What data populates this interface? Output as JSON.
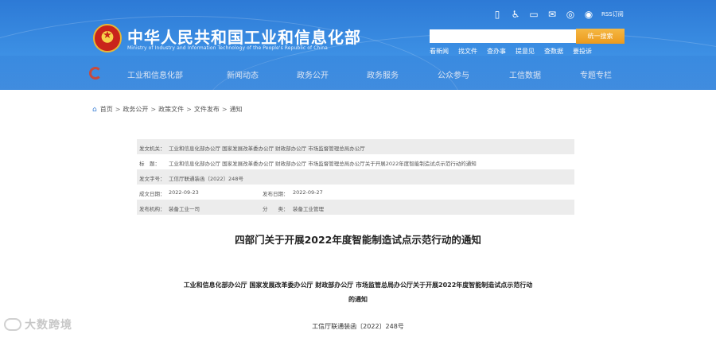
{
  "header": {
    "title": "中华人民共和国工业和信息化部",
    "subtitle": "Ministry of Industry and Information Technology of the People's Republic of China",
    "emblem_icon": "national-emblem-icon",
    "top_icons": [
      "mobile-icon",
      "accessibility-icon",
      "phone-icon",
      "mail-icon",
      "wechat-icon",
      "weibo-icon"
    ],
    "rss_label": "RSS订阅",
    "search": {
      "placeholder": "",
      "button_label": "统一搜索"
    },
    "quick_links": [
      "看新闻",
      "找文件",
      "查办事",
      "提意见",
      "查数据",
      "要投诉"
    ],
    "nav": [
      "工业和信息化部",
      "新闻动态",
      "政务公开",
      "政务服务",
      "公众参与",
      "工信数据",
      "专题专栏"
    ],
    "colors": {
      "header_blue": "#3b8ee3",
      "search_orange": "#ec9a1d",
      "emblem_red": "#c9241b"
    }
  },
  "breadcrumb": [
    "首页",
    "政务公开",
    "政策文件",
    "文件发布",
    "通知"
  ],
  "info": {
    "issuer_label": "发文机关：",
    "issuer": "工业和信息化部办公厅 国家发展改革委办公厅 财政部办公厅 市场监督管理总局办公厅",
    "title_label": "标　题：",
    "title": "工业和信息化部办公厅 国家发展改革委办公厅 财政部办公厅 市场监督管理总局办公厅关于开展2022年度智能制造试点示范行动的通知",
    "doc_no_label": "发文字号：",
    "doc_no": "工信厅联通装函〔2022〕248号",
    "date_label": "成文日期：",
    "date": "2022-09-23",
    "pub_date_label": "发布日期：",
    "pub_date": "2022-09-27",
    "org_label": "发布机构：",
    "org": "装备工业一司",
    "category_label": "分　　类：",
    "category": "装备工业管理"
  },
  "article": {
    "title": "四部门关于开展2022年度智能制造试点示范行动的通知",
    "subtitle_line1": "工业和信息化部办公厅 国家发展改革委办公厅 财政部办公厅 市场监管总局办公厅关于开展2022年度智能制造试点示范行动",
    "subtitle_line2": "的通知",
    "doc_number": "工信厅联通装函〔2022〕248号"
  },
  "watermark": {
    "text": "大数跨境"
  }
}
